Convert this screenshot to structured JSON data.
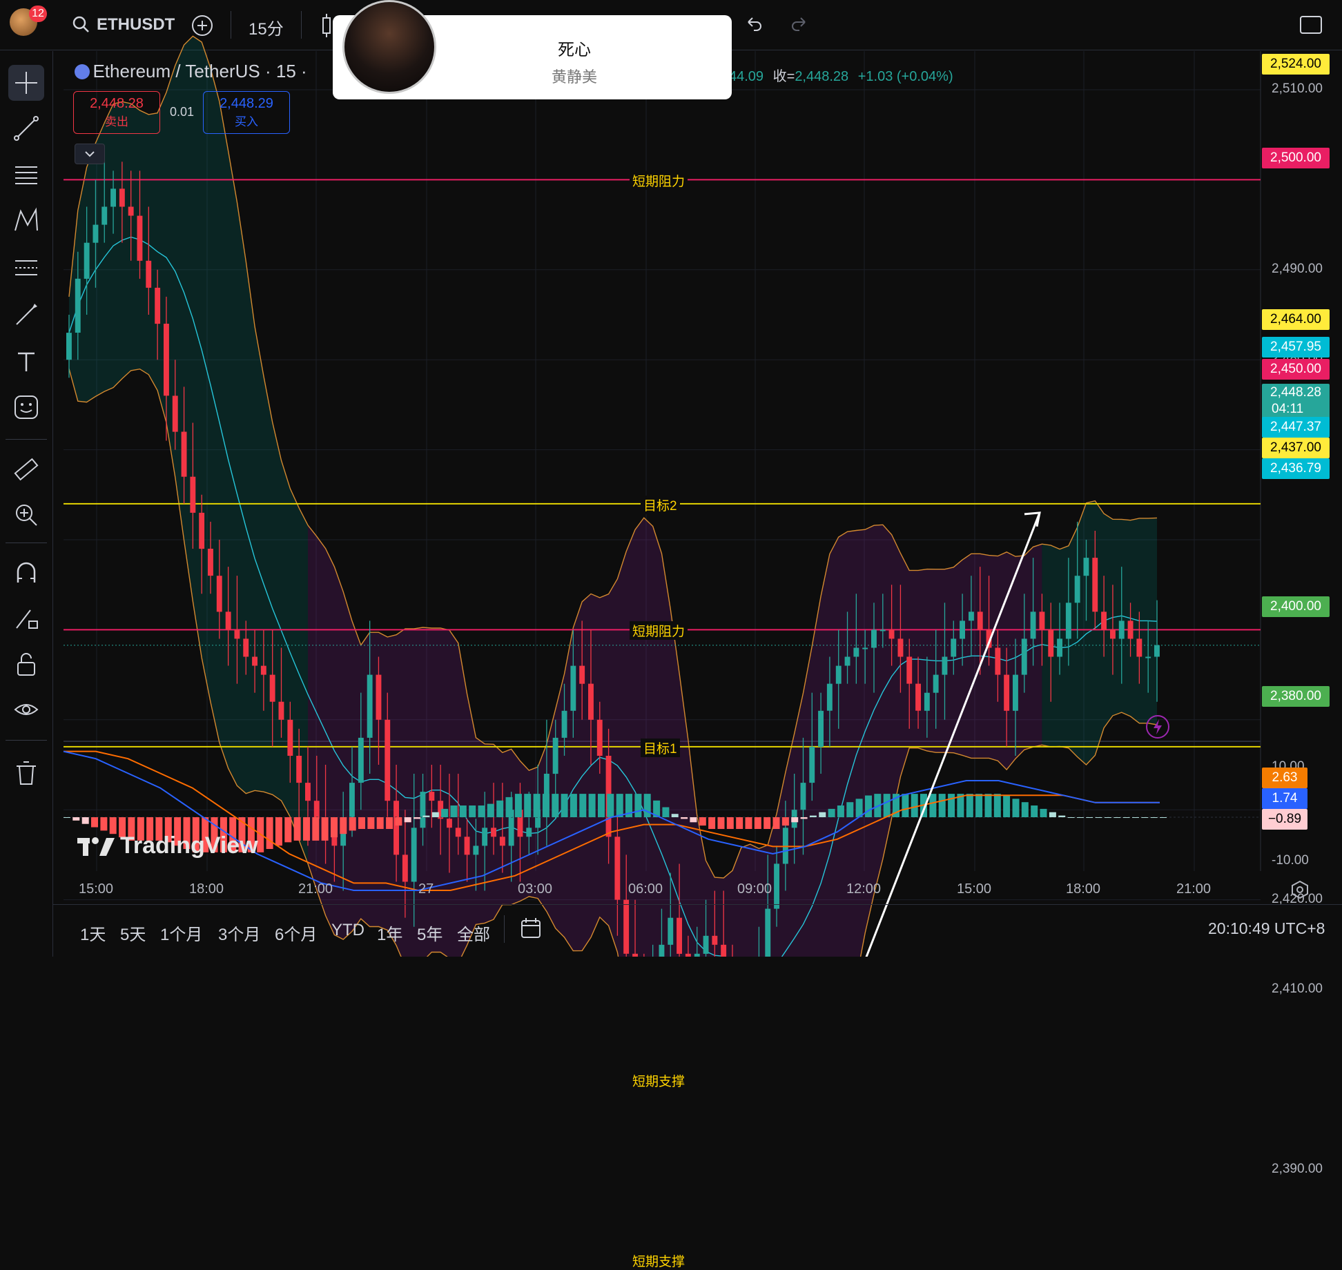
{
  "toolbar": {
    "notification_count": "12",
    "symbol": "ETHUSDT",
    "interval": "15分"
  },
  "legend": {
    "pair_title": "Ethereum / TetherUS · 15 ·",
    "ohlc_tail": "44.09",
    "close_label": "收=",
    "close_value": "2,448.28",
    "change": "+1.03 (+0.04%)",
    "sell_price": "2,448.28",
    "sell_label": "卖出",
    "spread": "0.01",
    "buy_price": "2,448.29",
    "buy_label": "买入"
  },
  "popup": {
    "title": "死心",
    "subtitle": "黄静美"
  },
  "levels": [
    {
      "label": "短期阻力",
      "price": 2500,
      "color": "#e91e63"
    },
    {
      "label": "目标2",
      "price": 2464,
      "color": "#e6d600"
    },
    {
      "label": "短期阻力",
      "price": 2450,
      "color": "#e91e63"
    },
    {
      "label": "目标1",
      "price": 2437,
      "color": "#e6d600"
    },
    {
      "label": "短期支撑",
      "price": 2400,
      "color": "#4caf50"
    },
    {
      "label": "短期支撑",
      "price": 2380,
      "color": "#4caf50"
    }
  ],
  "price_axis": {
    "ticks": [
      "2,510.00",
      "2,490.00",
      "2,480.00",
      "2,470.00",
      "2,420.00",
      "2,410.00",
      "2,390.00"
    ],
    "tags": [
      {
        "text": "2,524.00",
        "bg": "#ffeb3b",
        "fg": "#000000"
      },
      {
        "text": "2,500.00",
        "bg": "#e91e63",
        "fg": "#ffffff"
      },
      {
        "text": "2,464.00",
        "bg": "#ffeb3b",
        "fg": "#000000"
      },
      {
        "text": "2,457.95",
        "bg": "#00bcd4",
        "fg": "#ffffff"
      },
      {
        "text": "2,450.00",
        "bg": "#e91e63",
        "fg": "#ffffff"
      },
      {
        "text": "2,448.28",
        "bg": "#26a69a",
        "fg": "#ffffff"
      },
      {
        "text": "2,447.37",
        "bg": "#00bcd4",
        "fg": "#ffffff"
      },
      {
        "text": "2,437.00",
        "bg": "#ffeb3b",
        "fg": "#000000"
      },
      {
        "text": "2,436.79",
        "bg": "#00bcd4",
        "fg": "#ffffff"
      },
      {
        "text": "2,400.00",
        "bg": "#4caf50",
        "fg": "#ffffff"
      },
      {
        "text": "2,380.00",
        "bg": "#4caf50",
        "fg": "#ffffff"
      }
    ],
    "countdown": "04:11"
  },
  "macd_axis": {
    "top_tick": "10.00",
    "bottom_tick": "-10.00",
    "tags": [
      {
        "text": "2.63",
        "bg": "#f57c00",
        "fg": "#ffffff"
      },
      {
        "text": "1.74",
        "bg": "#2962ff",
        "fg": "#ffffff"
      },
      {
        "text": "−0.89",
        "bg": "#ffcdd2",
        "fg": "#000000"
      }
    ]
  },
  "time_axis": [
    "15:00",
    "18:00",
    "21:00",
    "27",
    "03:00",
    "06:00",
    "09:00",
    "12:00",
    "15:00",
    "18:00",
    "21:00"
  ],
  "timeframes": [
    "1天",
    "5天",
    "1个月",
    "3个月",
    "6个月",
    "YTD",
    "1年",
    "5年",
    "全部"
  ],
  "clock": "20:10:49 UTC+8",
  "watermark": "TradingView",
  "chart_data": {
    "type": "candlestick",
    "title": "Ethereum / TetherUS · 15",
    "x_start": "15:00 (day 26)",
    "x_interval_minutes": 15,
    "ylim": [
      2378,
      2526
    ],
    "current_price": 2448.28,
    "closes": [
      2483,
      2489,
      2493,
      2495,
      2497,
      2499,
      2497,
      2496,
      2491,
      2488,
      2484,
      2476,
      2472,
      2467,
      2463,
      2459,
      2456,
      2452,
      2450,
      2449,
      2447,
      2446,
      2445,
      2442,
      2440,
      2436,
      2433,
      2431,
      2429,
      2427,
      2426,
      2429,
      2433,
      2438,
      2445,
      2440,
      2431,
      2425,
      2422,
      2428,
      2432,
      2431,
      2429,
      2428,
      2427,
      2425,
      2426,
      2428,
      2427,
      2426,
      2430,
      2427,
      2428,
      2430,
      2434,
      2438,
      2441,
      2446,
      2444,
      2440,
      2436,
      2427,
      2420,
      2414,
      2412,
      2410,
      2412,
      2415,
      2418,
      2414,
      2412,
      2414,
      2416,
      2415,
      2413,
      2408,
      2402,
      2406,
      2412,
      2419,
      2424,
      2428,
      2430,
      2433,
      2437,
      2441,
      2444,
      2446,
      2447,
      2448,
      2448,
      2450,
      2450,
      2449,
      2447,
      2444,
      2441,
      2443,
      2445,
      2447,
      2449,
      2451,
      2452,
      2450,
      2448,
      2445,
      2441,
      2445,
      2449,
      2452,
      2450,
      2447,
      2449,
      2453,
      2456,
      2458,
      2452,
      2450,
      2449,
      2451,
      2449,
      2447,
      2447,
      2448.28
    ],
    "upper_band_start": 2500,
    "lower_band_start": 2470,
    "annotation": "arrow from 2382 (09:00) to 2463 (16:30)",
    "macd": {
      "ylim": [
        -12,
        12
      ],
      "macd_line": [
        9,
        8,
        6,
        4,
        1,
        -2,
        -5,
        -7,
        -9,
        -10,
        -10,
        -10,
        -9,
        -8,
        -6,
        -4,
        -2,
        0,
        1,
        -1,
        -3,
        -4,
        -5,
        -4,
        -2,
        1,
        3,
        4,
        5,
        5,
        4,
        3,
        2,
        2,
        2
      ],
      "signal_line": [
        9,
        9,
        8,
        6,
        4,
        1,
        -2,
        -5,
        -7,
        -9,
        -9,
        -10,
        -10,
        -9,
        -8,
        -6,
        -4,
        -2,
        -1,
        -1,
        -2,
        -3,
        -4,
        -4,
        -3,
        -1,
        1,
        2,
        3,
        3,
        3,
        3,
        2,
        2,
        2
      ],
      "last_macd": 1.74,
      "last_signal": 2.63,
      "last_hist": -0.89
    }
  }
}
